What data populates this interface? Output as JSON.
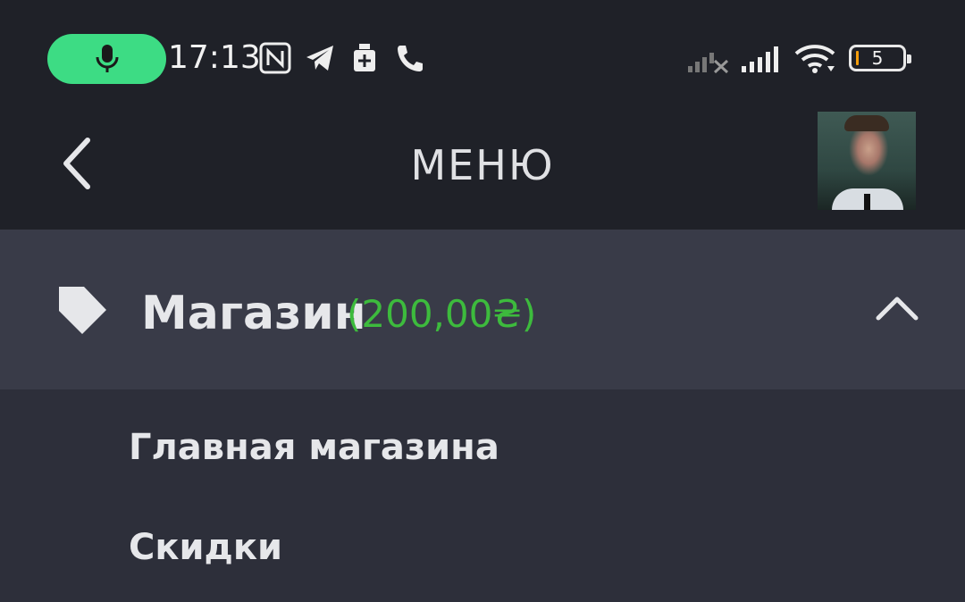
{
  "status_bar": {
    "time": "17:13",
    "battery_level": "5",
    "icons": [
      "mic-icon",
      "nfc-icon",
      "telegram-icon",
      "medical-icon",
      "phone-icon",
      "signal-no-service-icon",
      "signal-icon",
      "wifi-icon",
      "battery-icon"
    ],
    "mic_pill_color": "#3ddc84"
  },
  "header": {
    "title": "МЕНЮ",
    "back_icon": "chevron-left-icon",
    "avatar": "user-avatar"
  },
  "shop": {
    "label": "Магазин",
    "balance": "(200,00₴)",
    "balance_color": "#3dbb3d",
    "icon": "tag-icon",
    "expanded": true
  },
  "submenu": {
    "items": [
      {
        "label": "Главная магазина"
      },
      {
        "label": "Скидки"
      }
    ]
  },
  "colors": {
    "background": "#1f2128",
    "shop_row": "#393b48",
    "submenu": "#2d2f3a"
  }
}
